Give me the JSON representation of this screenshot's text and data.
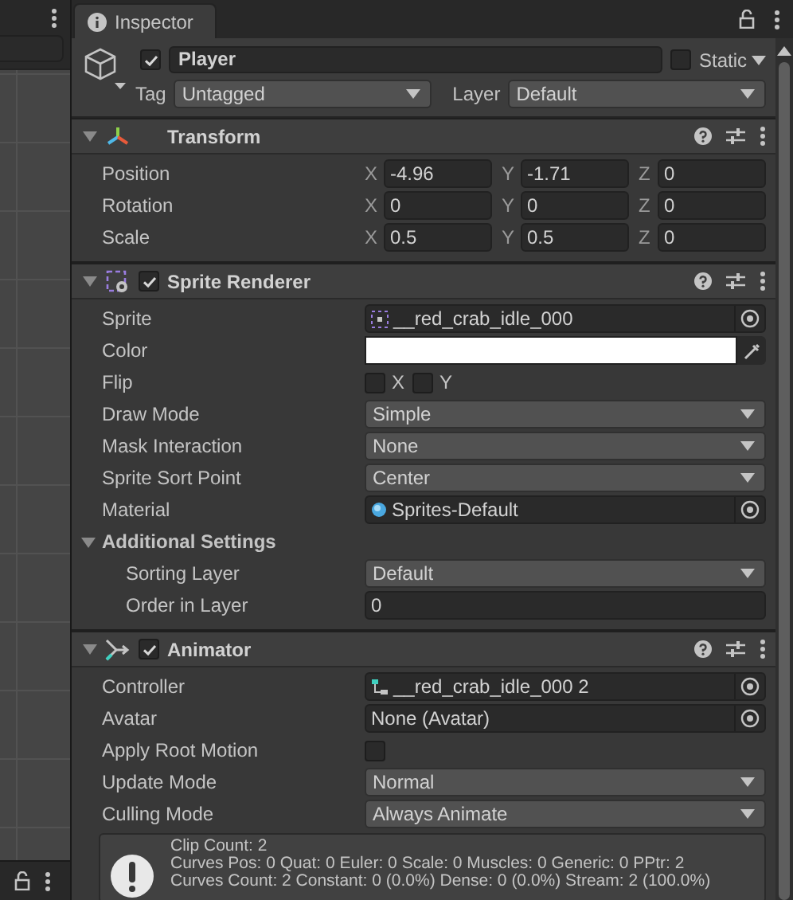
{
  "tabs": [
    {
      "label": "Inspector",
      "selected": true
    }
  ],
  "object": {
    "enabled": true,
    "name": "Player",
    "static": false,
    "static_label": "Static",
    "tag_label": "Tag",
    "tag": "Untagged",
    "layer_label": "Layer",
    "layer": "Default"
  },
  "components": [
    {
      "kind": "transform",
      "title": "Transform",
      "expanded": true,
      "rows": [
        {
          "kind": "vector",
          "label": "Position",
          "fields": [
            {
              "axis": "X",
              "value": "-4.96"
            },
            {
              "axis": "Y",
              "value": "-1.71"
            },
            {
              "axis": "Z",
              "value": "0"
            }
          ]
        },
        {
          "kind": "vector",
          "label": "Rotation",
          "fields": [
            {
              "axis": "X",
              "value": "0"
            },
            {
              "axis": "Y",
              "value": "0"
            },
            {
              "axis": "Z",
              "value": "0"
            }
          ]
        },
        {
          "kind": "vector",
          "label": "Scale",
          "fields": [
            {
              "axis": "X",
              "value": "0.5"
            },
            {
              "axis": "Y",
              "value": "0.5"
            },
            {
              "axis": "Z",
              "value": "0"
            }
          ]
        }
      ]
    },
    {
      "kind": "sprite_renderer",
      "title": "Sprite Renderer",
      "enabled": true,
      "expanded": true,
      "rows": [
        {
          "kind": "sprite_field",
          "label": "Sprite",
          "value": "__red_crab_idle_000"
        },
        {
          "kind": "color",
          "label": "Color",
          "color": "#ffffff"
        },
        {
          "kind": "flags",
          "label": "Flip",
          "options": [
            {
              "label": "X",
              "checked": false
            },
            {
              "label": "Y",
              "checked": false
            }
          ]
        },
        {
          "kind": "dropdown",
          "label": "Draw Mode",
          "value": "Simple"
        },
        {
          "kind": "dropdown",
          "label": "Mask Interaction",
          "value": "None"
        },
        {
          "kind": "dropdown",
          "label": "Sprite Sort Point",
          "value": "Center"
        },
        {
          "kind": "material_field",
          "label": "Material",
          "value": "Sprites-Default"
        },
        {
          "kind": "section",
          "label": "Additional Settings",
          "expanded": true,
          "children": [
            {
              "kind": "dropdown",
              "label": "Sorting Layer",
              "value": "Default"
            },
            {
              "kind": "number",
              "label": "Order in Layer",
              "value": "0"
            }
          ]
        }
      ]
    },
    {
      "kind": "animator",
      "title": "Animator",
      "enabled": true,
      "expanded": true,
      "rows": [
        {
          "kind": "controller_field",
          "label": "Controller",
          "value": "__red_crab_idle_000 2"
        },
        {
          "kind": "object_field",
          "label": "Avatar",
          "value": "None (Avatar)"
        },
        {
          "kind": "checkbox",
          "label": "Apply Root Motion",
          "checked": false
        },
        {
          "kind": "dropdown",
          "label": "Update Mode",
          "value": "Normal"
        },
        {
          "kind": "dropdown",
          "label": "Culling Mode",
          "value": "Always Animate"
        },
        {
          "kind": "info",
          "lines": [
            "Clip Count: 2",
            "Curves Pos: 0 Quat: 0 Euler: 0 Scale: 0 Muscles: 0 Generic: 0 PPtr: 2",
            "Curves Count: 2 Constant: 0 (0.0%) Dense: 0 (0.0%) Stream: 2 (100.0%)"
          ]
        }
      ]
    }
  ]
}
